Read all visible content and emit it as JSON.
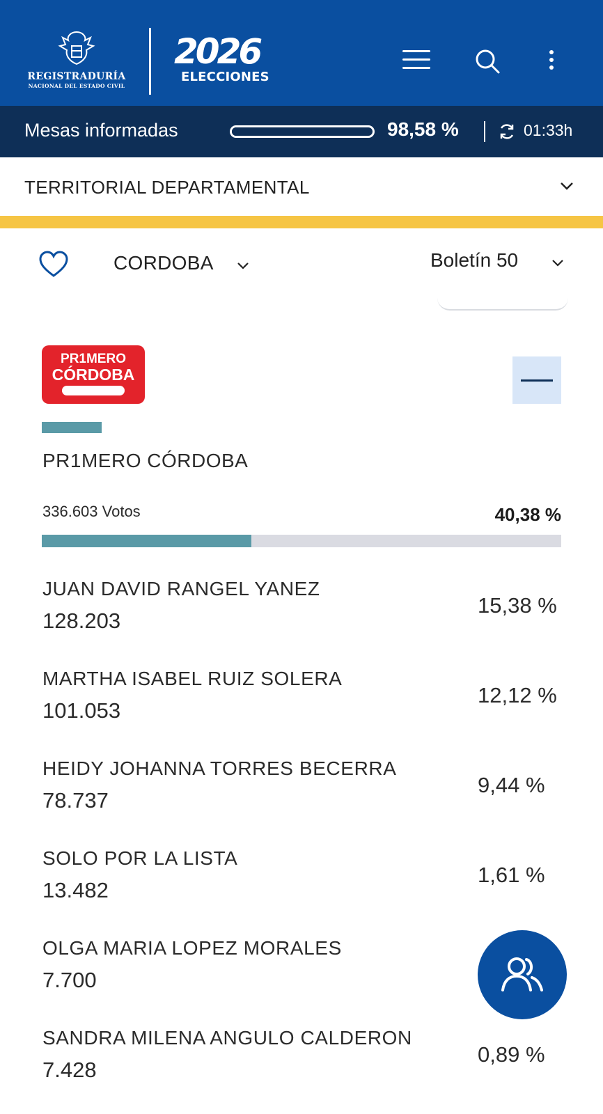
{
  "header": {
    "registry_name": "REGISTRADURÍA",
    "registry_sub": "NACIONAL DEL ESTADO CIVIL",
    "election_year": "2026",
    "election_label": "ELECCIONES",
    "icons": [
      "menu-icon",
      "search-icon",
      "more-vertical-icon"
    ]
  },
  "mesas": {
    "label": "Mesas informadas",
    "progress_percent": 98.58,
    "percent_text": "98,58 %",
    "time": "01:33h"
  },
  "territorial": {
    "label": "TERRITORIAL DEPARTAMENTAL"
  },
  "filters": {
    "department": "CORDOBA",
    "bulletin": "Boletín 50"
  },
  "party": {
    "logo_top": "PR1MERO",
    "logo_bottom": "CÓRDOBA",
    "name": "PR1MERO CÓRDOBA",
    "votes": "336.603 Votos",
    "percent": "40,38 %",
    "percent_value": 40.38,
    "color": "#5a9aa7"
  },
  "candidates": [
    {
      "name": "JUAN DAVID RANGEL YANEZ",
      "votes": "128.203",
      "percent": "15,38 %"
    },
    {
      "name": "MARTHA ISABEL RUIZ SOLERA",
      "votes": "101.053",
      "percent": "12,12 %"
    },
    {
      "name": "HEIDY JOHANNA TORRES BECERRA",
      "votes": "78.737",
      "percent": "9,44 %"
    },
    {
      "name": "SOLO POR LA LISTA",
      "votes": "13.482",
      "percent": "1,61 %"
    },
    {
      "name": "OLGA MARIA LOPEZ MORALES",
      "votes": "7.700",
      "percent": ""
    },
    {
      "name": "SANDRA MILENA ANGULO CALDERON",
      "votes": "7.428",
      "percent": "0,89 %"
    }
  ],
  "colors": {
    "header_blue": "#0a4fa0",
    "dark_navy": "#0e2f57",
    "accent_yellow": "#f6c544",
    "party_red": "#e3232b"
  }
}
